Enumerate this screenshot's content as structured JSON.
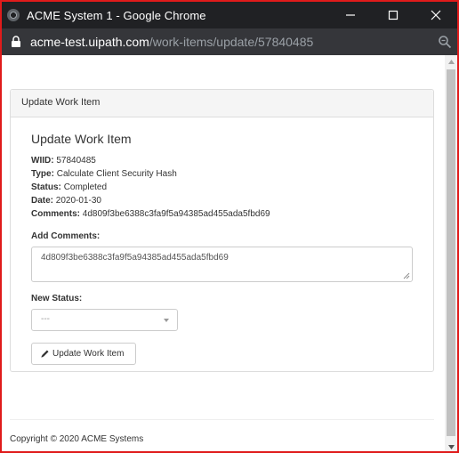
{
  "window": {
    "title": "ACME System 1 - Google Chrome"
  },
  "addressbar": {
    "host": "acme-test.uipath.com",
    "path": "/work-items/update/57840485"
  },
  "panel": {
    "heading": "Update Work Item"
  },
  "form": {
    "title": "Update Work Item",
    "wiid_label": "WIID:",
    "wiid": "57840485",
    "type_label": "Type:",
    "type": "Calculate Client Security Hash",
    "status_label": "Status:",
    "status": "Completed",
    "date_label": "Date:",
    "date": "2020-01-30",
    "comments_label": "Comments:",
    "comments": "4d809f3be6388c3fa9f5a94385ad455ada5fbd69",
    "add_comments_label": "Add Comments:",
    "add_comments_value": "4d809f3be6388c3fa9f5a94385ad455ada5fbd69",
    "new_status_label": "New Status:",
    "new_status_selected": "---",
    "submit_label": "Update Work Item"
  },
  "footer": {
    "copyright": "Copyright © 2020 ACME Systems"
  },
  "colors": {
    "titlebar": "#202124",
    "addressbar": "#35363a",
    "border_highlight": "#e01b1b",
    "panel_heading_bg": "#f5f5f5"
  },
  "icons": {
    "app": "chrome-logo-icon",
    "minimize": "minimize-icon",
    "maximize": "maximize-icon",
    "close": "close-icon",
    "secure": "lock-icon",
    "zoom": "zoom-icon",
    "submit": "pencil-icon",
    "select": "caret-down-icon"
  }
}
